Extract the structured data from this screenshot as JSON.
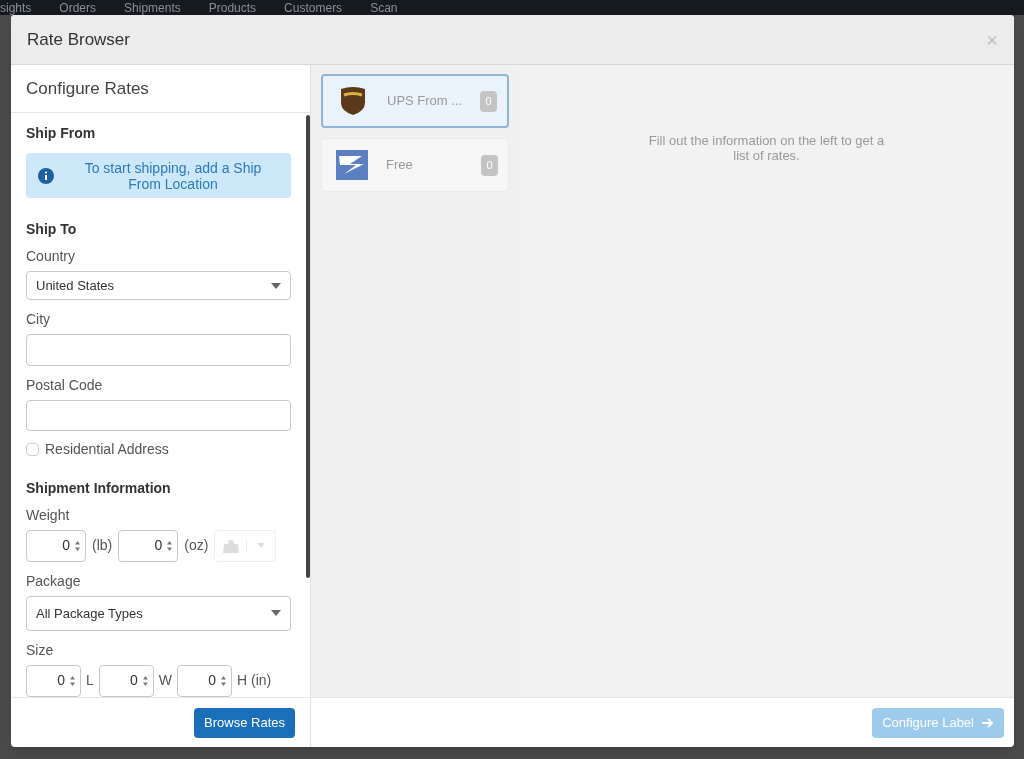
{
  "backdrop": {
    "nav": [
      "sights",
      "Orders",
      "Shipments",
      "Products",
      "Customers",
      "Scan"
    ]
  },
  "window": {
    "title": "Rate Browser",
    "close": "×"
  },
  "configure": {
    "title": "Configure Rates",
    "ship_from": {
      "heading": "Ship From",
      "notice": "To start shipping, add a Ship From Location"
    },
    "ship_to": {
      "heading": "Ship To",
      "country_label": "Country",
      "country": "United States",
      "city_label": "City",
      "postal_label": "Postal Code",
      "residential": {
        "label": "Residential Address",
        "checked": false
      }
    },
    "shipment": {
      "heading": "Shipment Information",
      "weight_label": "Weight",
      "weight": [
        {
          "value": "0",
          "unit": "(lb)"
        },
        {
          "value": "0",
          "unit": "(oz)"
        }
      ],
      "package_label": "Package",
      "package": "All Package Types",
      "size_label": "Size",
      "size": [
        {
          "value": "0",
          "unit": "L"
        },
        {
          "value": "0",
          "unit": "W"
        },
        {
          "value": "0",
          "unit": "H (in)"
        }
      ]
    },
    "browse_button": "Browse Rates"
  },
  "carriers": [
    {
      "kind": "ups",
      "name": "UPS From ...",
      "count": "0",
      "selected": true
    },
    {
      "kind": "usps",
      "name": "Free",
      "count": "0",
      "selected": false
    }
  ],
  "rates": {
    "message": "Fill out the information on the left to get a list of rates."
  },
  "configure_label": {
    "label": "Configure Label",
    "disabled": true
  }
}
